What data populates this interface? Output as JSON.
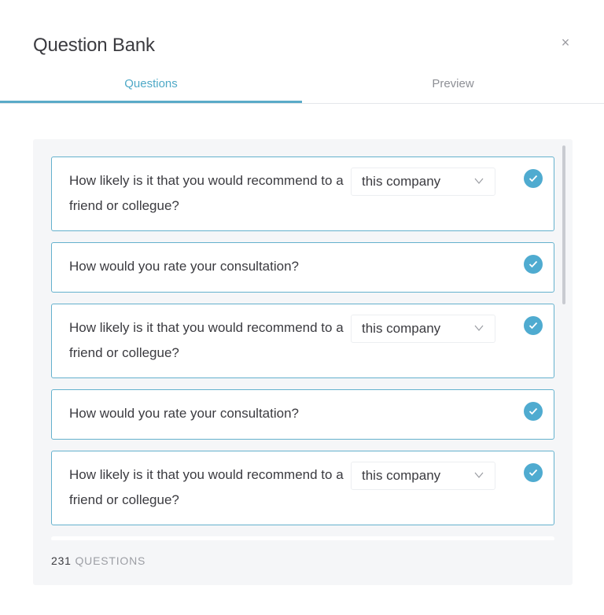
{
  "header": {
    "title": "Question Bank",
    "close_icon": "close-icon",
    "close_glyph": "×"
  },
  "tabs": [
    {
      "label": "Questions",
      "active": true
    },
    {
      "label": "Preview",
      "active": false
    }
  ],
  "questions": [
    {
      "text": "How likely is it that you would recommend to a friend or collegue?",
      "select_value": "this company",
      "selected": true
    },
    {
      "text": "How would you rate your consultation?",
      "selected": true
    },
    {
      "text": "How likely is it that you would recommend to a friend or collegue?",
      "select_value": "this company",
      "selected": true
    },
    {
      "text": "How would you rate your consultation?",
      "selected": true
    },
    {
      "text": "How likely is it that you would recommend to a friend or collegue?",
      "select_value": "this company",
      "selected": true
    }
  ],
  "footer": {
    "count": "231",
    "count_label": "QUESTIONS"
  },
  "colors": {
    "accent": "#4fabd0",
    "card_border": "#64b1cd",
    "panel_bg": "#f5f6f8"
  }
}
